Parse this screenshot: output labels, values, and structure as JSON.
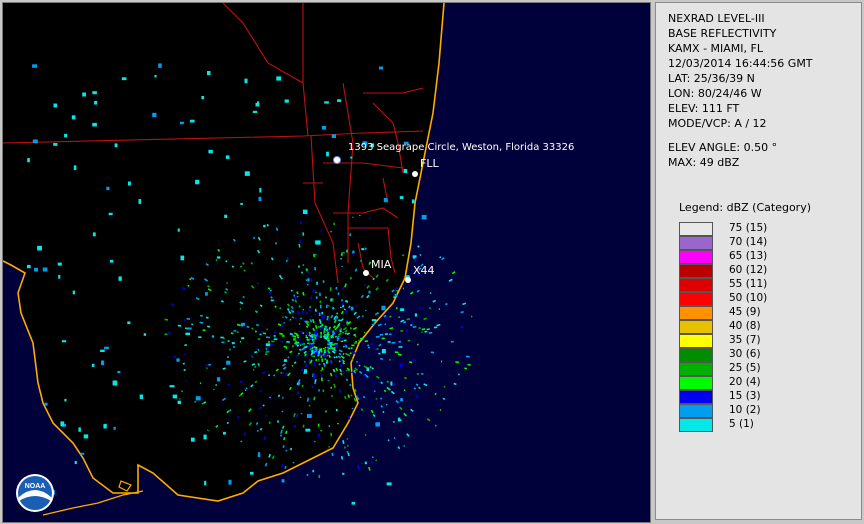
{
  "product": {
    "title_line1": "NEXRAD LEVEL-III",
    "title_line2": "BASE REFLECTIVITY",
    "station": "KAMX - MIAMI, FL",
    "datetime": "12/03/2014 16:44:56 GMT",
    "lat": "LAT: 25/36/39 N",
    "lon": "LON: 80/24/46 W",
    "elev": "ELEV: 111 FT",
    "mode": "MODE/VCP: A / 12",
    "elev_angle": "ELEV ANGLE: 0.50 °",
    "max": "MAX: 49 dBZ"
  },
  "legend": {
    "title": "Legend: dBZ (Category)",
    "items": [
      {
        "label": "75  (15)",
        "color": "#e8e8e8"
      },
      {
        "label": "70  (14)",
        "color": "#9966cc"
      },
      {
        "label": "65  (13)",
        "color": "#ff00ff"
      },
      {
        "label": "60  (12)",
        "color": "#bb0000"
      },
      {
        "label": "55  (11)",
        "color": "#dd0000"
      },
      {
        "label": "50  (10)",
        "color": "#ff0000"
      },
      {
        "label": "45  (9)",
        "color": "#ff9000"
      },
      {
        "label": "40  (8)",
        "color": "#e7c000"
      },
      {
        "label": "35  (7)",
        "color": "#ffff00"
      },
      {
        "label": "30  (6)",
        "color": "#008e00"
      },
      {
        "label": "25  (5)",
        "color": "#00b000"
      },
      {
        "label": "20  (4)",
        "color": "#00fa00"
      },
      {
        "label": "15  (3)",
        "color": "#0000f0"
      },
      {
        "label": "10  (2)",
        "color": "#009ef0"
      },
      {
        "label": "5  (1)",
        "color": "#04e9e7"
      }
    ]
  },
  "map": {
    "address_label": "1393 Seagrape Circle, Weston, Florida 33326",
    "markers": {
      "fll": "FLL",
      "mia": "MIA",
      "x44": "X44"
    },
    "colors": {
      "background": "#00003a",
      "coastline": "#ffaa00",
      "roads": "#c01010"
    }
  },
  "logo": {
    "text": "NOAA"
  }
}
